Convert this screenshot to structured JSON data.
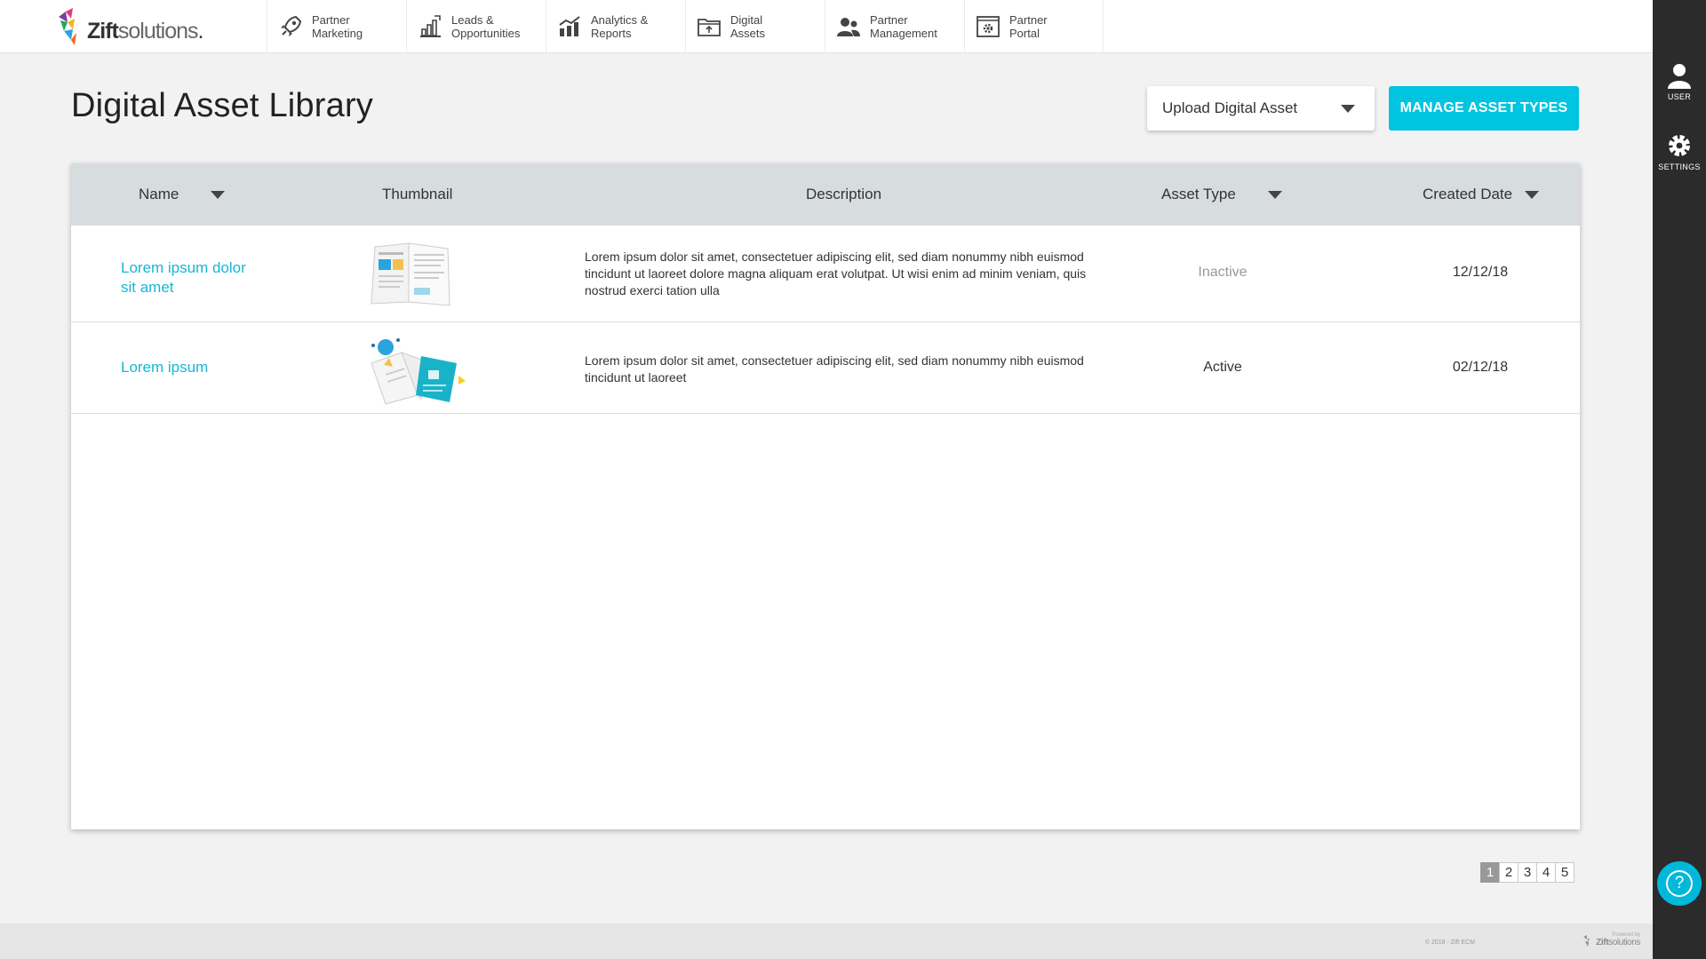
{
  "brand": {
    "name_bold": "Zift",
    "name_light": "solutions",
    "dot": "."
  },
  "nav": [
    {
      "label": "Partner\nMarketing",
      "icon": "rocket-icon"
    },
    {
      "label": "Leads &\nOpportunities",
      "icon": "leads-chart-icon"
    },
    {
      "label": "Analytics &\nReports",
      "icon": "analytics-chart-icon"
    },
    {
      "label": "Digital\nAssets",
      "icon": "folder-upload-icon"
    },
    {
      "label": "Partner\nManagement",
      "icon": "people-icon"
    },
    {
      "label": "Partner\nPortal",
      "icon": "portal-gear-icon"
    }
  ],
  "rail": {
    "user_label": "USER",
    "settings_label": "SETTINGS",
    "help_glyph": "?"
  },
  "page": {
    "title": "Digital Asset Library",
    "upload_label": "Upload Digital Asset",
    "manage_label": "MANAGE ASSET TYPES"
  },
  "table": {
    "headers": {
      "name": "Name",
      "thumbnail": "Thumbnail",
      "description": "Description",
      "asset_type": "Asset Type",
      "created_date": "Created Date"
    },
    "rows": [
      {
        "name": "Lorem ipsum dolor sit amet",
        "thumbnail": "brochure-thumbnail",
        "description": "Lorem ipsum dolor sit amet, consectetuer adipiscing elit, sed diam nonummy nibh euismod tincidunt ut laoreet dolore magna aliquam erat volutpat. Ut wisi enim ad minim veniam, quis nostrud exerci tation ulla",
        "asset_type": "Inactive",
        "created_date": "12/12/18"
      },
      {
        "name": "Lorem ipsum",
        "thumbnail": "booklet-thumbnail",
        "description": "Lorem ipsum dolor sit amet, consectetuer adipiscing elit, sed diam nonummy nibh euismod tincidunt ut laoreet",
        "asset_type": "Active",
        "created_date": "02/12/18"
      }
    ]
  },
  "pagination": {
    "pages": [
      "1",
      "2",
      "3",
      "4",
      "5"
    ],
    "current": "1"
  },
  "footer": {
    "copyright": "© 2018 - Zift ECM",
    "powered_by": "Powered by",
    "powered_bold": "Zift",
    "powered_light": "solutions"
  },
  "colors": {
    "accent": "#00c4e0",
    "link": "#18b6d3",
    "header_bg": "#d7dcdf",
    "rail_bg": "#2b2b2b"
  }
}
